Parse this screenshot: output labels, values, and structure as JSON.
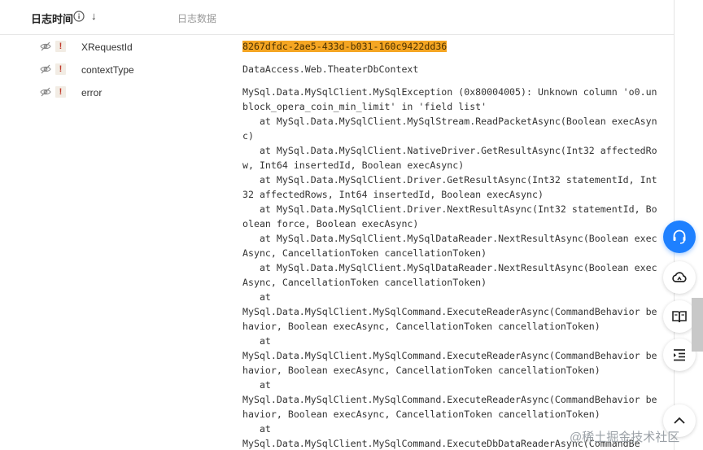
{
  "header": {
    "time_label": "日志时间",
    "data_label": "日志数据",
    "info_icon": "info-circle-icon",
    "sort_icon": "arrow-down-icon",
    "sort_glyph": "↓"
  },
  "rows": [
    {
      "field": "XRequestId",
      "value": "8267dfdc-2ae5-433d-b031-160c9422dd36",
      "highlighted": true
    },
    {
      "field": "contextType",
      "value": "DataAccess.Web.TheaterDbContext",
      "highlighted": false
    },
    {
      "field": "error",
      "value": "MySql.Data.MySqlClient.MySqlException (0x80004005): Unknown column 'o0.unblock_opera_coin_min_limit' in 'field list'\n   at MySql.Data.MySqlClient.MySqlStream.ReadPacketAsync(Boolean execAsync)\n   at MySql.Data.MySqlClient.NativeDriver.GetResultAsync(Int32 affectedRow, Int64 insertedId, Boolean execAsync)\n   at MySql.Data.MySqlClient.Driver.GetResultAsync(Int32 statementId, Int32 affectedRows, Int64 insertedId, Boolean execAsync)\n   at MySql.Data.MySqlClient.Driver.NextResultAsync(Int32 statementId, Boolean force, Boolean execAsync)\n   at MySql.Data.MySqlClient.MySqlDataReader.NextResultAsync(Boolean execAsync, CancellationToken cancellationToken)\n   at MySql.Data.MySqlClient.MySqlDataReader.NextResultAsync(Boolean execAsync, CancellationToken cancellationToken)\n   at\nMySql.Data.MySqlClient.MySqlCommand.ExecuteReaderAsync(CommandBehavior behavior, Boolean execAsync, CancellationToken cancellationToken)\n   at\nMySql.Data.MySqlClient.MySqlCommand.ExecuteReaderAsync(CommandBehavior behavior, Boolean execAsync, CancellationToken cancellationToken)\n   at\nMySql.Data.MySqlClient.MySqlCommand.ExecuteReaderAsync(CommandBehavior behavior, Boolean execAsync, CancellationToken cancellationToken)\n   at\nMySql.Data.MySqlClient.MySqlCommand.ExecuteDbDataReaderAsync(CommandBe",
      "highlighted": false
    }
  ],
  "row_icons": {
    "visibility": "eye-slash-icon",
    "warning": "exclamation-icon",
    "warning_glyph": "!"
  },
  "sidebar_buttons": [
    "headset-support-icon",
    "cloud-icon",
    "book-icon",
    "list-outdent-icon",
    "chevron-up-icon"
  ],
  "watermark": "@稀土掘金技术社区",
  "colors": {
    "highlight": "#f5a623",
    "accent": "#1e80ff"
  }
}
